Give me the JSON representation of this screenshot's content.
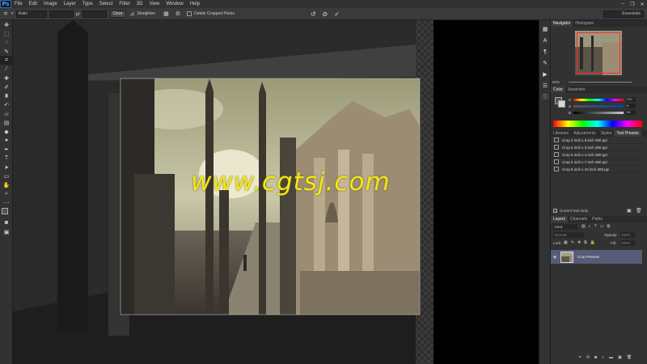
{
  "app": {
    "logo": "Ps"
  },
  "menu": [
    "File",
    "Edit",
    "Image",
    "Layer",
    "Type",
    "Select",
    "Filter",
    "3D",
    "View",
    "Window",
    "Help"
  ],
  "window_controls": [
    "–",
    "❐",
    "✕"
  ],
  "options": {
    "ratio_label": "Ratio",
    "clear_label": "Clear",
    "straighten_label": "Straighten",
    "delete_cropped_label": "Delete Cropped Pixels",
    "workspace": "Essentials"
  },
  "navigator": {
    "tabs": [
      "Navigator",
      "Histogram"
    ],
    "zoom": "50%"
  },
  "color": {
    "tabs": [
      "Color",
      "Swatches"
    ],
    "rows": [
      {
        "label": "H",
        "value": "220"
      },
      {
        "label": "S",
        "value": "8"
      },
      {
        "label": "B",
        "value": "38"
      }
    ]
  },
  "presets": {
    "tabs": [
      "Libraries",
      "Adjustments",
      "Styles",
      "Tool Presets"
    ],
    "items": [
      "Crop 4 inch x 6 inch 300 ppi",
      "Crop 5 inch x 3 inch 300 ppi",
      "Crop 5 inch x 4 inch 300 ppi",
      "Crop 5 inch x 7 inch 300 ppi",
      "Crop 8 inch x 10 inch 300 ppi"
    ],
    "current_only": "Current Tool Only"
  },
  "layers": {
    "tabs": [
      "Layers",
      "Channels",
      "Paths"
    ],
    "kind": "Kind",
    "blend": "Normal",
    "opacity_label": "Opacity:",
    "opacity": "100%",
    "lock_label": "Lock:",
    "fill_label": "Fill:",
    "fill": "100%",
    "layer_name": "Crop Preview"
  },
  "watermark": "www.cgtsj.com",
  "colors": {
    "accent_watermark": "#f3e71a",
    "layer_selected": "#565c78"
  }
}
